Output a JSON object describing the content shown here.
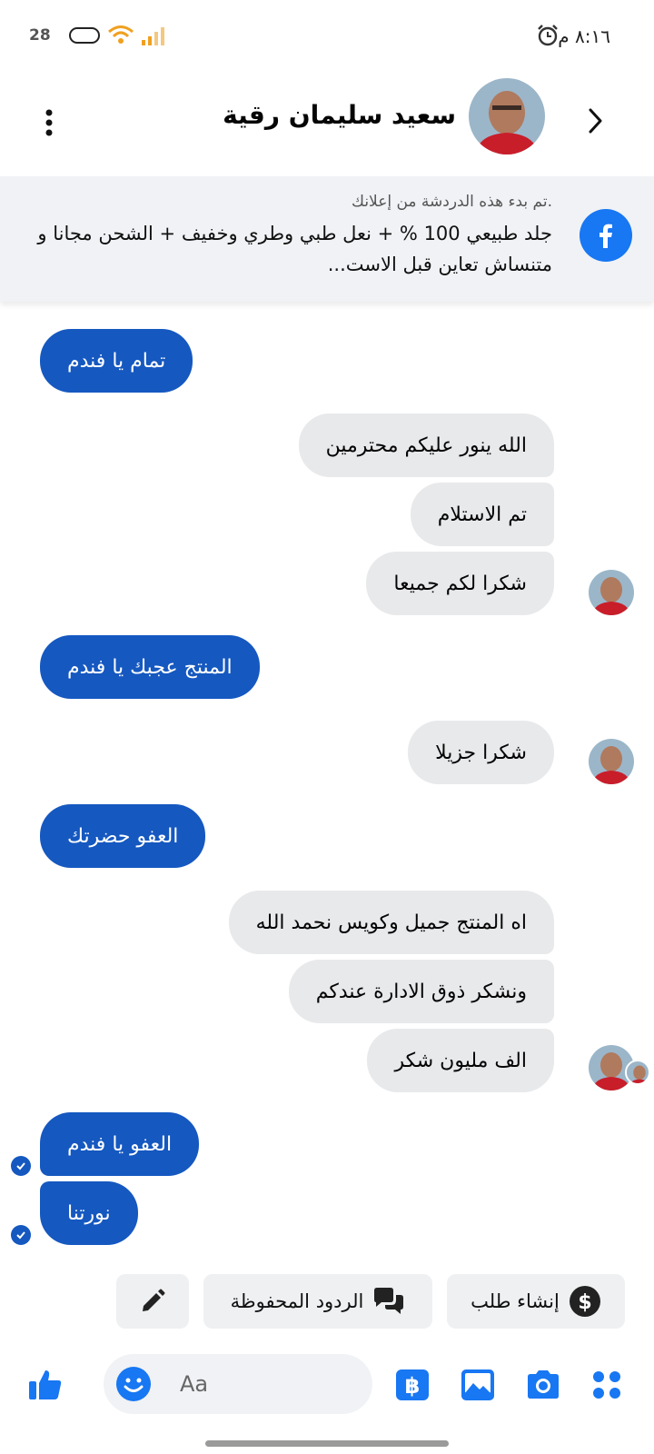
{
  "status_bar": {
    "time": "٨:١٦ م",
    "battery": "28"
  },
  "header": {
    "contact_name": "سعيد سليمان رقية"
  },
  "ad": {
    "note": ".تم بدء هذه الدردشة من إعلانك",
    "text": "جلد طبيعي 100 % + نعل طبي وطري وخفيف + الشحن مجانا و متنساش تعاين قبل الاست..."
  },
  "messages": [
    {
      "dir": "sent",
      "text": "تمام يا فندم"
    },
    {
      "dir": "received",
      "text": "الله ينور عليكم محترمين"
    },
    {
      "dir": "received",
      "text": "تم الاستلام"
    },
    {
      "dir": "received",
      "text": "شكرا لكم جميعا"
    },
    {
      "dir": "sent",
      "text": "المنتج عجبك يا فندم"
    },
    {
      "dir": "received",
      "text": "شكرا جزيلا"
    },
    {
      "dir": "sent",
      "text": "العفو حضرتك"
    },
    {
      "dir": "received",
      "text": "اه المنتج جميل وكويس نحمد الله"
    },
    {
      "dir": "received",
      "text": "ونشكر ذوق الادارة عندكم"
    },
    {
      "dir": "received",
      "text": "الف مليون شكر"
    },
    {
      "dir": "sent",
      "text": "العفو يا فندم"
    },
    {
      "dir": "sent",
      "text": "نورتنا"
    }
  ],
  "quick_actions": {
    "create_order": "إنشاء طلب",
    "saved_replies": "الردود المحفوظة"
  },
  "composer": {
    "placeholder": "Aa"
  },
  "colors": {
    "accent": "#1558c0",
    "facebook_blue": "#1877f2",
    "received_bubble": "#e8e9eb"
  },
  "icons": [
    "back-icon",
    "more-icon",
    "facebook-icon",
    "dollar-icon",
    "chat-bubbles-icon",
    "pencil-icon",
    "like-icon",
    "emoji-icon",
    "baht-icon",
    "image-icon",
    "camera-icon",
    "apps-icon"
  ]
}
